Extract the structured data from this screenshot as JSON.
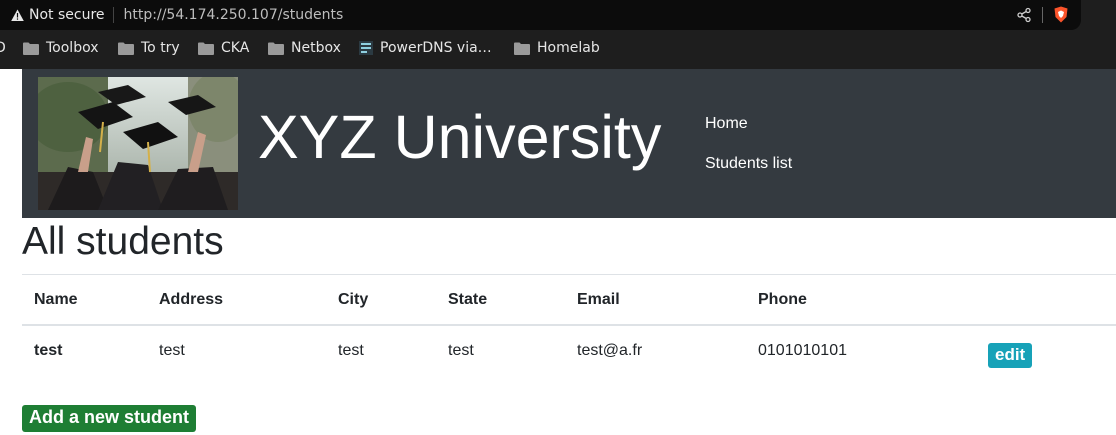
{
  "browser": {
    "security_label": "Not secure",
    "url": "http://54.174.250.107/students",
    "bookmarks_partial": "D",
    "bookmarks": [
      {
        "label": "Toolbox",
        "icon": "folder-icon"
      },
      {
        "label": "To try",
        "icon": "folder-icon"
      },
      {
        "label": "CKA",
        "icon": "folder-icon"
      },
      {
        "label": "Netbox",
        "icon": "folder-icon"
      },
      {
        "label": "PowerDNS via…",
        "icon": "powerdns-icon"
      },
      {
        "label": "Homelab",
        "icon": "folder-icon"
      }
    ]
  },
  "header": {
    "title": "XYZ University",
    "nav": [
      {
        "label": "Home"
      },
      {
        "label": "Students list"
      }
    ],
    "background_color": "#343a40"
  },
  "main": {
    "heading": "All students",
    "table": {
      "columns": [
        "Name",
        "Address",
        "City",
        "State",
        "Email",
        "Phone"
      ],
      "rows": [
        {
          "name": "test",
          "address": "test",
          "city": "test",
          "state": "test",
          "email": "test@a.fr",
          "phone": "0101010101",
          "action_label": "edit"
        }
      ]
    },
    "add_button_label": "Add a new student"
  },
  "colors": {
    "edit_button": "#17a2b8",
    "add_button": "#1e7e34",
    "brave_accent": "#fb542b"
  }
}
